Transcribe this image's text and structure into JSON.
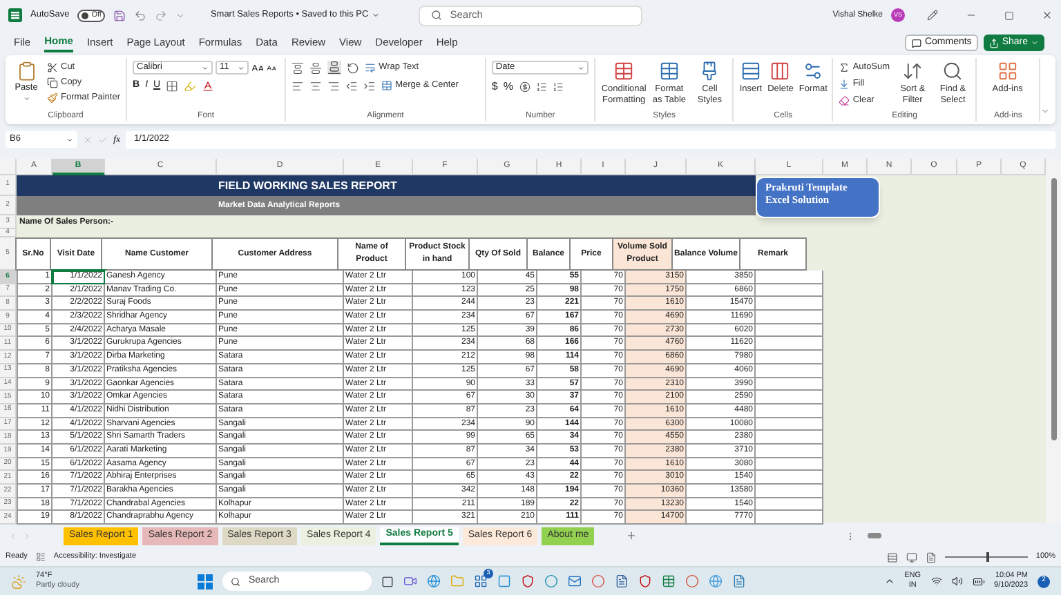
{
  "title_bar": {
    "autosave": {
      "label": "AutoSave",
      "on": false,
      "state_text": "Off"
    },
    "document_title": "Smart Sales Reports • Saved to this PC",
    "search": {
      "placeholder": "Search"
    },
    "user_name": "Vishal Shelke",
    "avatar_initials": "VS"
  },
  "menu_tabs": [
    {
      "label": "File",
      "selected": false
    },
    {
      "label": "Home",
      "selected": true
    },
    {
      "label": "Insert",
      "selected": false
    },
    {
      "label": "Page Layout",
      "selected": false
    },
    {
      "label": "Formulas",
      "selected": false
    },
    {
      "label": "Data",
      "selected": false
    },
    {
      "label": "Review",
      "selected": false
    },
    {
      "label": "View",
      "selected": false
    },
    {
      "label": "Developer",
      "selected": false
    },
    {
      "label": "Help",
      "selected": false
    }
  ],
  "comments_button": "Comments",
  "share_button": "Share",
  "ribbon": {
    "clipboard": {
      "paste": "Paste",
      "cut": "Cut",
      "copy": "Copy",
      "format_painter": "Format Painter",
      "label": "Clipboard"
    },
    "font": {
      "name": "Calibri",
      "size": "11",
      "bold": "B",
      "italic": "I",
      "underline": "U",
      "label": "Font"
    },
    "alignment": {
      "wrap_text": "Wrap Text",
      "merge": "Merge & Center",
      "label": "Alignment"
    },
    "number": {
      "format": "Date",
      "currency": "$",
      "percent": "%",
      "label": "Number"
    },
    "styles": {
      "items": [
        "Conditional Formatting",
        "Format as Table",
        "Cell Styles"
      ],
      "label": "Styles"
    },
    "cells": {
      "items": [
        "Insert",
        "Delete",
        "Format"
      ],
      "label": "Cells"
    },
    "editing": {
      "autosum": "AutoSum",
      "fill": "Fill",
      "clear": "Clear",
      "sort": "Sort & Filter",
      "find": "Find & Select",
      "label": "Editing"
    },
    "addins": {
      "item": "Add-ins",
      "label": "Add-ins"
    }
  },
  "formula_bar": {
    "name_box": "B6",
    "fx": "fx",
    "formula": "1/1/2022"
  },
  "sheet": {
    "column_headers": [
      {
        "label": "A",
        "selected": false
      },
      {
        "label": "B",
        "selected": true
      },
      {
        "label": "C",
        "selected": false
      },
      {
        "label": "D",
        "selected": false
      },
      {
        "label": "E",
        "selected": false
      },
      {
        "label": "F",
        "selected": false
      },
      {
        "label": "G",
        "selected": false
      },
      {
        "label": "H",
        "selected": false
      },
      {
        "label": "I",
        "selected": false
      },
      {
        "label": "J",
        "selected": false
      },
      {
        "label": "K",
        "selected": false
      },
      {
        "label": "L",
        "selected": false
      },
      {
        "label": "M",
        "selected": false
      },
      {
        "label": "N",
        "selected": false
      },
      {
        "label": "O",
        "selected": false
      },
      {
        "label": "P",
        "selected": false
      },
      {
        "label": "Q",
        "selected": false
      }
    ],
    "row_numbers": [
      "1",
      "2",
      "3",
      "4",
      "5"
    ],
    "banner_title": "FIELD WORKING SALES REPORT",
    "banner_subtitle": "Market Data Analytical Reports",
    "sales_person_label": "Name Of Sales Person:-",
    "callout": "Prakruti Template Excel Solution",
    "table": {
      "columns": [
        "Sr.No",
        "Visit Date",
        "Name Customer",
        "Customer Address",
        "Name of Product",
        "Product Stock in hand",
        "Qty Of Sold",
        "Balance",
        "Price",
        "Volume Sold Product",
        "Balance Volume",
        "Remark"
      ],
      "rows": [
        {
          "row_number": "6",
          "selected": true,
          "cells": [
            "1",
            "1/1/2022",
            "Ganesh Agency",
            "Pune",
            "Water 2 Ltr",
            "100",
            "45",
            "55",
            "70",
            "3150",
            "3850"
          ]
        },
        {
          "row_number": "7",
          "selected": false,
          "cells": [
            "2",
            "2/1/2022",
            "Manav Trading Co.",
            "Pune",
            "Water 2 Ltr",
            "123",
            "25",
            "98",
            "70",
            "1750",
            "6860"
          ]
        },
        {
          "row_number": "8",
          "selected": false,
          "cells": [
            "3",
            "2/2/2022",
            "Suraj Foods",
            "Pune",
            "Water 2 Ltr",
            "244",
            "23",
            "221",
            "70",
            "1610",
            "15470"
          ]
        },
        {
          "row_number": "9",
          "selected": false,
          "cells": [
            "4",
            "2/3/2022",
            "Shridhar Agency",
            "Pune",
            "Water 2 Ltr",
            "234",
            "67",
            "167",
            "70",
            "4690",
            "11690"
          ]
        },
        {
          "row_number": "10",
          "selected": false,
          "cells": [
            "5",
            "2/4/2022",
            "Acharya Masale",
            "Pune",
            "Water 2 Ltr",
            "125",
            "39",
            "86",
            "70",
            "2730",
            "6020"
          ]
        },
        {
          "row_number": "11",
          "selected": false,
          "cells": [
            "6",
            "3/1/2022",
            "Gurukrupa Agencies",
            "Pune",
            "Water 2 Ltr",
            "234",
            "68",
            "166",
            "70",
            "4760",
            "11620"
          ]
        },
        {
          "row_number": "12",
          "selected": false,
          "cells": [
            "7",
            "3/1/2022",
            "Dirba Marketing",
            "Satara",
            "Water 2 Ltr",
            "212",
            "98",
            "114",
            "70",
            "6860",
            "7980"
          ]
        },
        {
          "row_number": "13",
          "selected": false,
          "cells": [
            "8",
            "3/1/2022",
            "Pratiksha Agencies",
            "Satara",
            "Water 2 Ltr",
            "125",
            "67",
            "58",
            "70",
            "4690",
            "4060"
          ]
        },
        {
          "row_number": "14",
          "selected": false,
          "cells": [
            "9",
            "3/1/2022",
            "Gaonkar Agencies",
            "Satara",
            "Water 2 Ltr",
            "90",
            "33",
            "57",
            "70",
            "2310",
            "3990"
          ]
        },
        {
          "row_number": "15",
          "selected": false,
          "cells": [
            "10",
            "3/1/2022",
            "Omkar Agencies",
            "Satara",
            "Water 2 Ltr",
            "67",
            "30",
            "37",
            "70",
            "2100",
            "2590"
          ]
        },
        {
          "row_number": "16",
          "selected": false,
          "cells": [
            "11",
            "4/1/2022",
            "Nidhi Distribution",
            "Satara",
            "Water 2 Ltr",
            "87",
            "23",
            "64",
            "70",
            "1610",
            "4480"
          ]
        },
        {
          "row_number": "17",
          "selected": false,
          "cells": [
            "12",
            "4/1/2022",
            "Sharvani Agencies",
            "Sangali",
            "Water 2 Ltr",
            "234",
            "90",
            "144",
            "70",
            "6300",
            "10080"
          ]
        },
        {
          "row_number": "18",
          "selected": false,
          "cells": [
            "13",
            "5/1/2022",
            "Shri Samarth Traders",
            "Sangali",
            "Water 2 Ltr",
            "99",
            "65",
            "34",
            "70",
            "4550",
            "2380"
          ]
        },
        {
          "row_number": "19",
          "selected": false,
          "cells": [
            "14",
            "6/1/2022",
            "Aarati Marketing",
            "Sangali",
            "Water 2 Ltr",
            "87",
            "34",
            "53",
            "70",
            "2380",
            "3710"
          ]
        },
        {
          "row_number": "20",
          "selected": false,
          "cells": [
            "15",
            "6/1/2022",
            "Aasama Agency",
            "Sangali",
            "Water 2 Ltr",
            "67",
            "23",
            "44",
            "70",
            "1610",
            "3080"
          ]
        },
        {
          "row_number": "21",
          "selected": false,
          "cells": [
            "16",
            "7/1/2022",
            "Abhiraj Enterprises",
            "Sangali",
            "Water 2 Ltr",
            "65",
            "43",
            "22",
            "70",
            "3010",
            "1540"
          ]
        },
        {
          "row_number": "22",
          "selected": false,
          "cells": [
            "17",
            "7/1/2022",
            "Barakha Agencies",
            "Sangali",
            "Water 2 Ltr",
            "342",
            "148",
            "194",
            "70",
            "10360",
            "13580"
          ]
        },
        {
          "row_number": "23",
          "selected": false,
          "cells": [
            "18",
            "7/1/2022",
            "Chandrabal Agencies",
            "Kolhapur",
            "Water 2 Ltr",
            "211",
            "189",
            "22",
            "70",
            "13230",
            "1540"
          ]
        },
        {
          "row_number": "24",
          "selected": false,
          "cells": [
            "19",
            "8/1/2022",
            "Chandraprabhu Agency",
            "Kolhapur",
            "Water 2 Ltr",
            "321",
            "210",
            "111",
            "70",
            "14700",
            "7770"
          ]
        }
      ]
    }
  },
  "sheet_tabs": [
    {
      "label": "Sales Report 1",
      "color": "#ffc000",
      "selected": false
    },
    {
      "label": "Sales Report 2",
      "color": "#e6b8b7",
      "selected": false
    },
    {
      "label": "Sales Report 3",
      "color": "#ddd9c4",
      "selected": false
    },
    {
      "label": "Sales Report 4",
      "color": "#ebf1de",
      "selected": false
    },
    {
      "label": "Sales Report 5",
      "color": "#ffffff",
      "selected": true
    },
    {
      "label": "Sales Report 6",
      "color": "#fde9d9",
      "selected": false
    },
    {
      "label": "About me",
      "color": "#92d050",
      "selected": false
    }
  ],
  "status_bar": {
    "status": "Ready",
    "accessibility": "Accessibility: Investigate",
    "zoom_slider": {
      "level": 0.5
    },
    "zoom": "100%"
  },
  "taskbar": {
    "weather_temp": "74°F",
    "weather_text": "Partly cloudy",
    "search_placeholder": "Search",
    "store_badge": "3",
    "language": "ENG",
    "region": "IN",
    "time": "10:04 PM",
    "date": "9/10/2023",
    "notification_count": "2"
  }
}
